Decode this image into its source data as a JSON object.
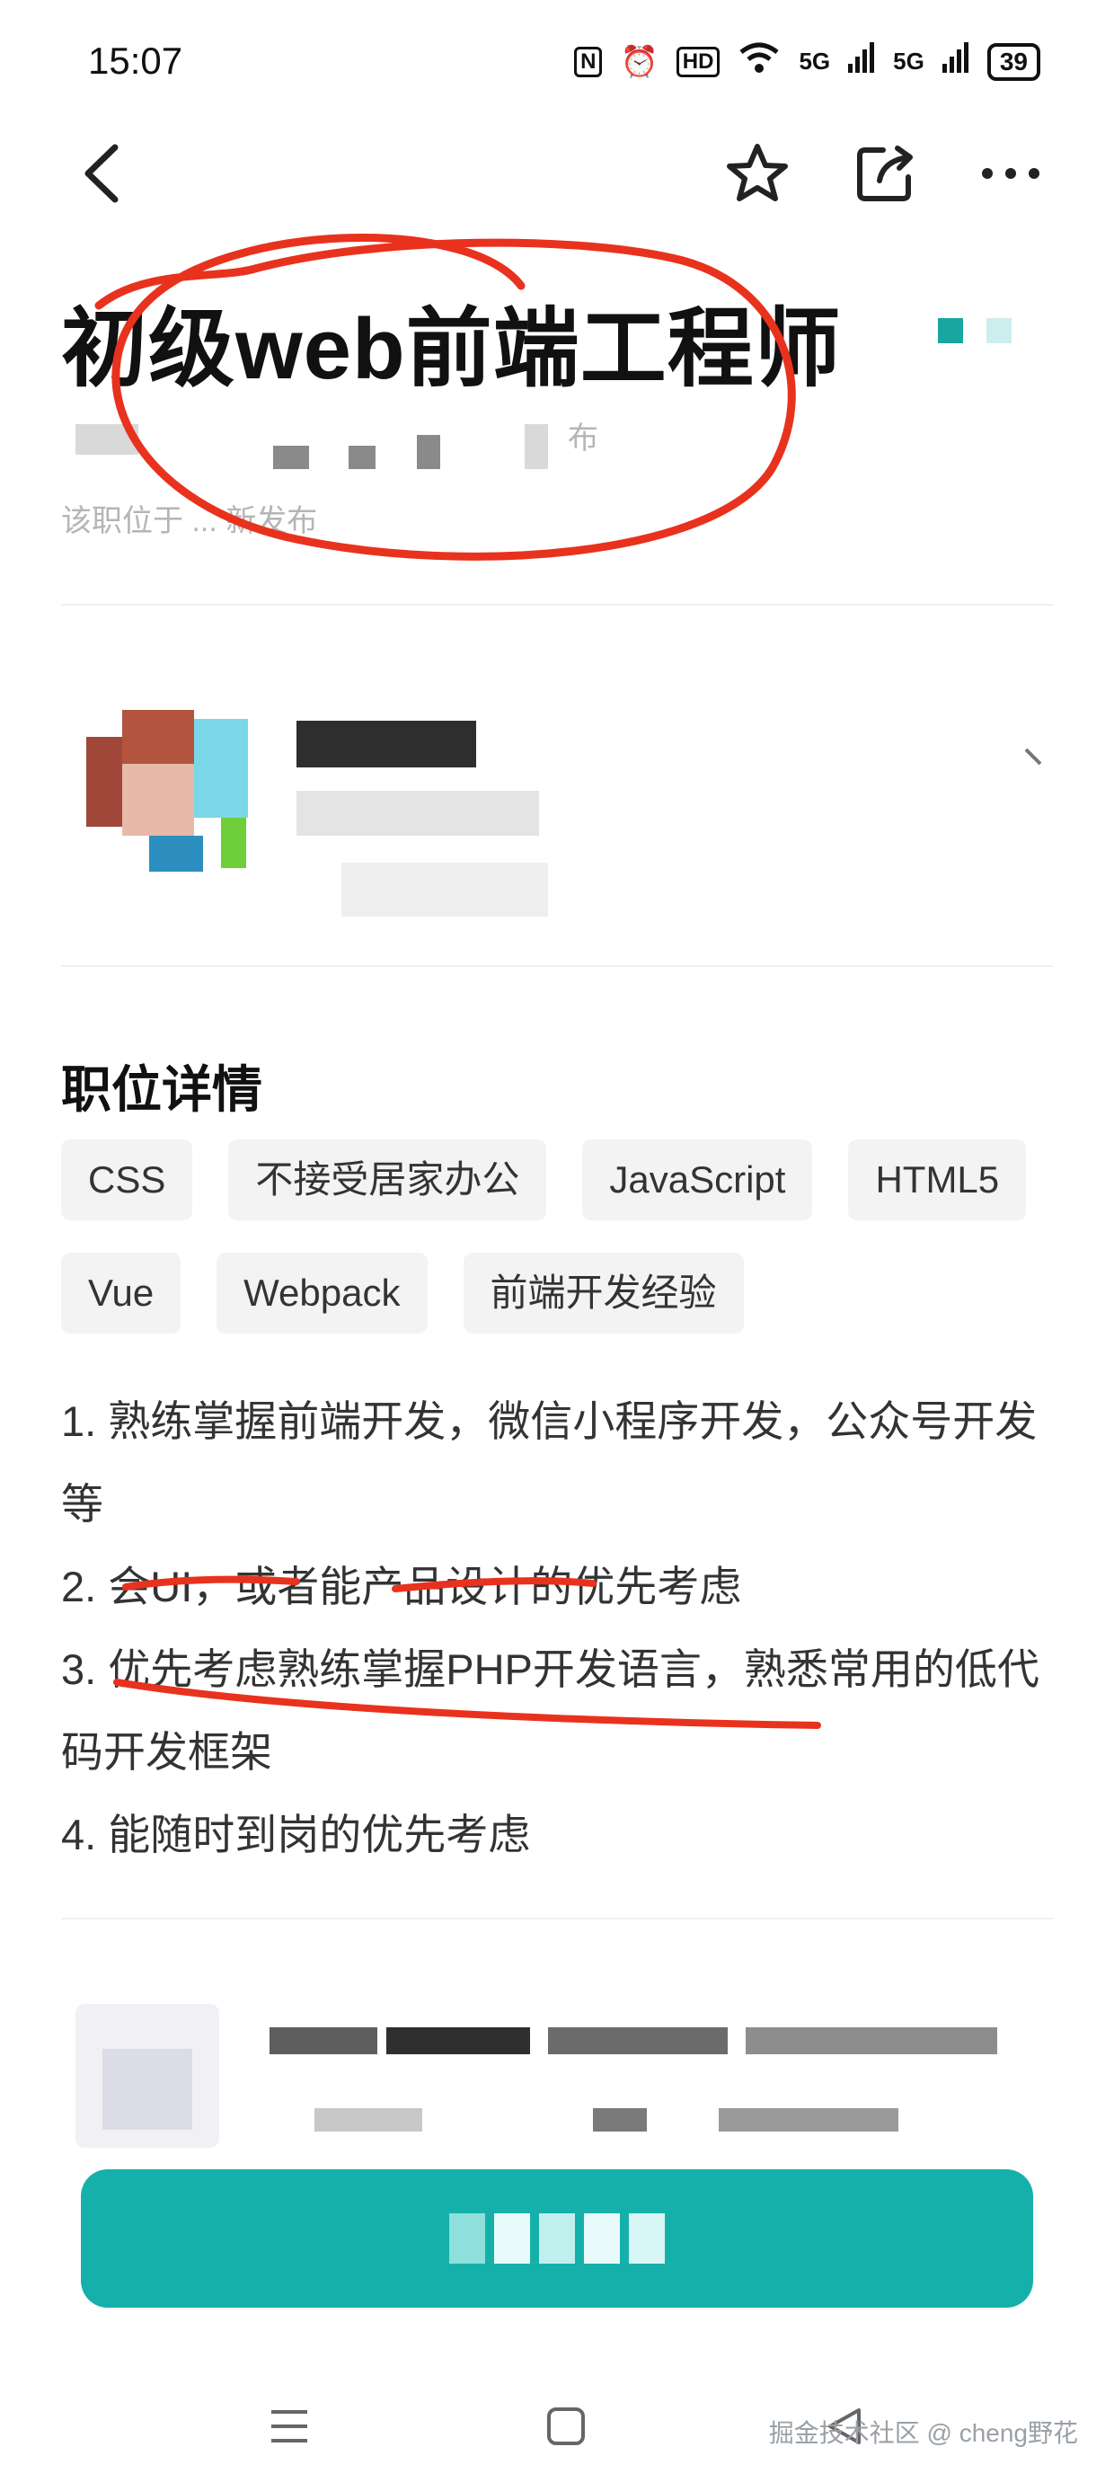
{
  "status_bar": {
    "time": "15:07",
    "nfc": "N",
    "hd": "HD",
    "signal1": "5G",
    "signal2": "5G",
    "battery": "39"
  },
  "header": {
    "back_icon": "chevron-left-icon",
    "favorite_icon": "star-icon",
    "share_icon": "share-icon",
    "more_icon": "more-icon"
  },
  "job": {
    "title": "初级web前端工程师",
    "subtitle_tail": "布",
    "published_text": "该职位于 ... 新发布"
  },
  "details": {
    "section_title": "职位详情",
    "tags": [
      "CSS",
      "不接受居家办公",
      "JavaScript",
      "HTML5",
      "Vue",
      "Webpack",
      "前端开发经验"
    ],
    "requirements": [
      "1. 熟练掌握前端开发，微信小程序开发，公众号开发等",
      "2. 会UI，或者能产品设计的优先考虑",
      "3. 优先考虑熟练掌握PHP开发语言，熟悉常用的低代码开发框架",
      "4. 能随时到岗的优先考虑"
    ]
  },
  "colors": {
    "accent": "#16b0ab",
    "annotation": "#e8321e",
    "tag_bg": "#f3f3f3"
  },
  "footer": {
    "watermark": "掘金技术社区 @ cheng野花"
  }
}
